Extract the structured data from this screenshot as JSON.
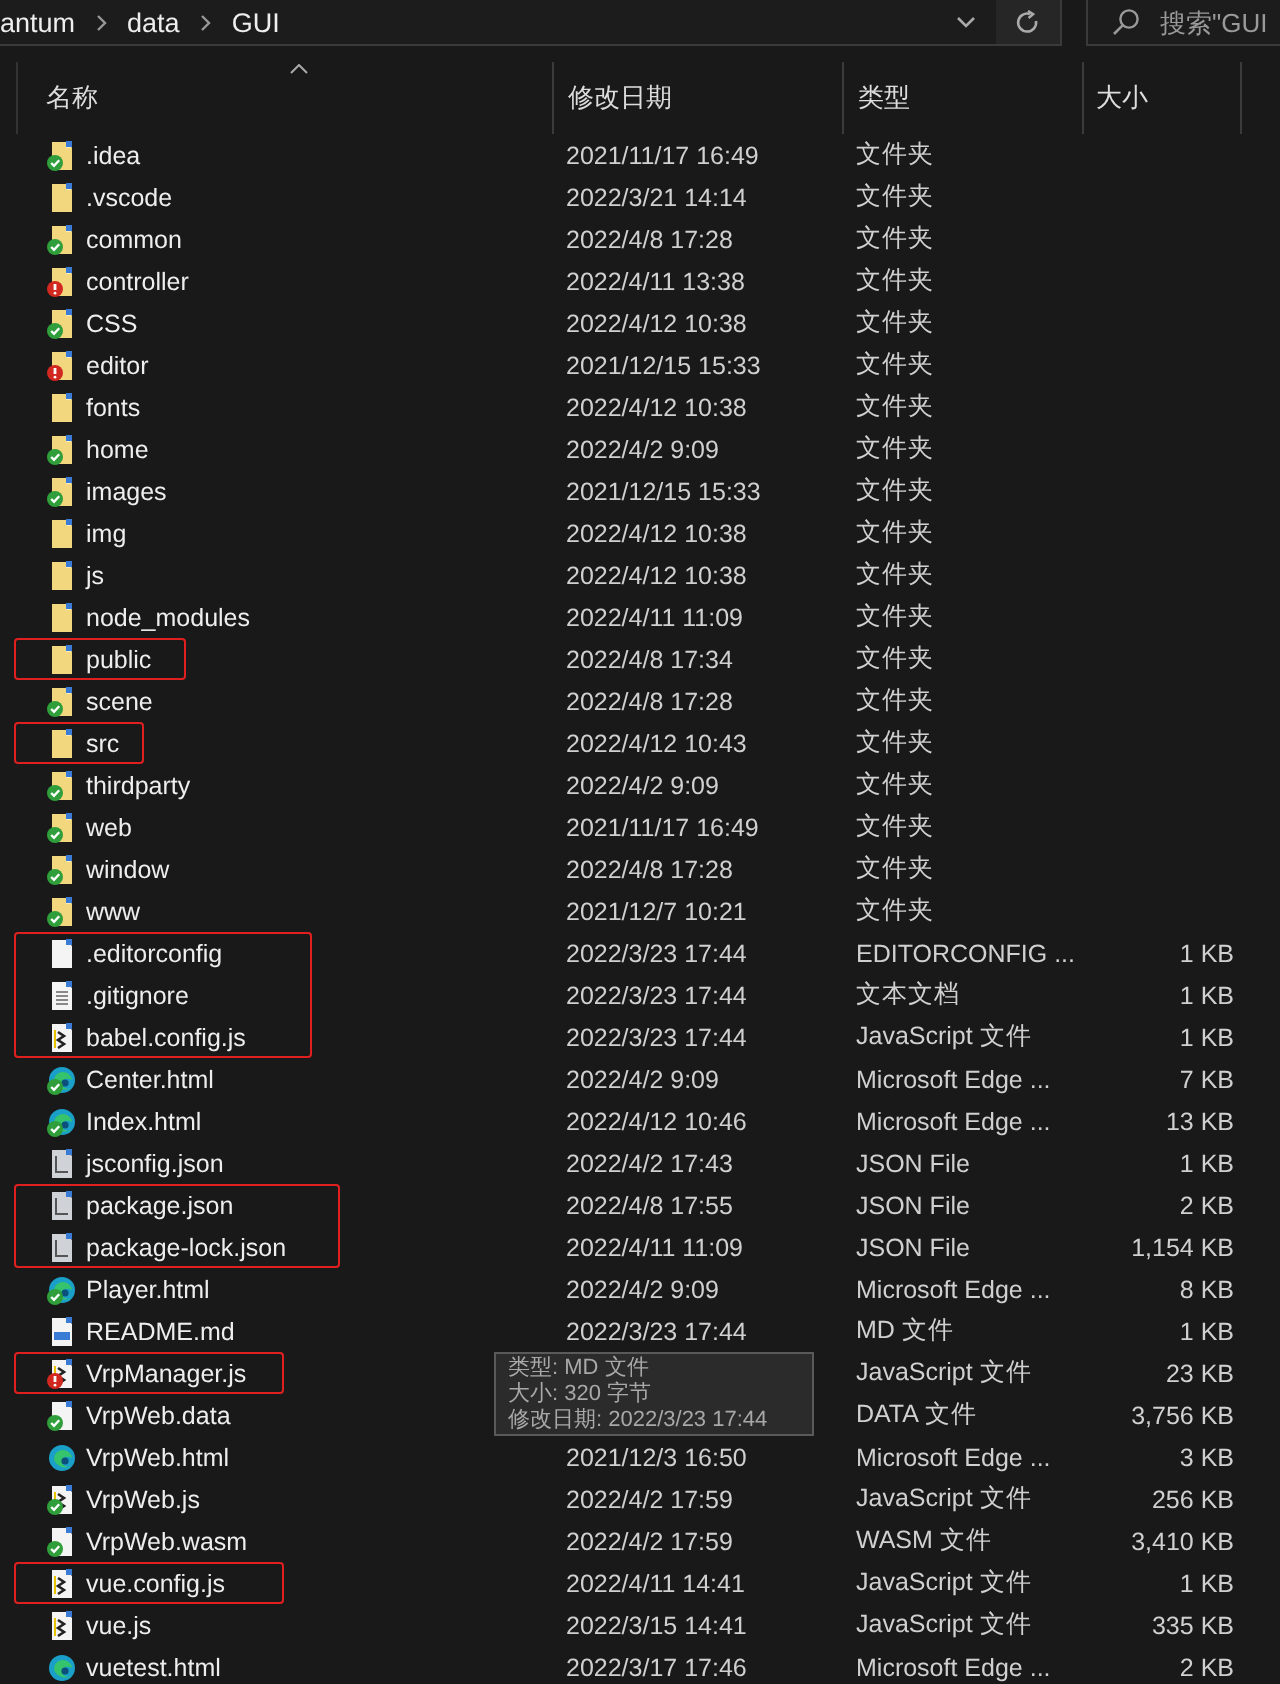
{
  "breadcrumb": [
    "antum",
    "data",
    "GUI"
  ],
  "search": {
    "placeholder": "搜索\"GUI"
  },
  "columns": [
    "名称",
    "修改日期",
    "类型",
    "大小"
  ],
  "files": [
    {
      "name": ".idea",
      "date": "2021/11/17 16:49",
      "type": "文件夹",
      "kind": "folder",
      "synced": true,
      "error": false,
      "marked": false
    },
    {
      "name": ".vscode",
      "date": "2022/3/21 14:14",
      "type": "文件夹",
      "kind": "folder",
      "synced": false,
      "error": false,
      "marked": false
    },
    {
      "name": "common",
      "date": "2022/4/8 17:28",
      "type": "文件夹",
      "kind": "folder",
      "synced": true,
      "error": false,
      "marked": false
    },
    {
      "name": "controller",
      "date": "2022/4/11 13:38",
      "type": "文件夹",
      "kind": "folder",
      "synced": false,
      "error": true,
      "marked": false
    },
    {
      "name": "CSS",
      "date": "2022/4/12 10:38",
      "type": "文件夹",
      "kind": "folder",
      "synced": true,
      "error": false,
      "marked": false
    },
    {
      "name": "editor",
      "date": "2021/12/15 15:33",
      "type": "文件夹",
      "kind": "folder",
      "synced": false,
      "error": true,
      "marked": false
    },
    {
      "name": "fonts",
      "date": "2022/4/12 10:38",
      "type": "文件夹",
      "kind": "folder",
      "synced": false,
      "error": false,
      "marked": false
    },
    {
      "name": "home",
      "date": "2022/4/2 9:09",
      "type": "文件夹",
      "kind": "folder",
      "synced": true,
      "error": false,
      "marked": false
    },
    {
      "name": "images",
      "date": "2021/12/15 15:33",
      "type": "文件夹",
      "kind": "folder",
      "synced": true,
      "error": false,
      "marked": false
    },
    {
      "name": "img",
      "date": "2022/4/12 10:38",
      "type": "文件夹",
      "kind": "folder",
      "synced": false,
      "error": false,
      "marked": false
    },
    {
      "name": "js",
      "date": "2022/4/12 10:38",
      "type": "文件夹",
      "kind": "folder",
      "synced": false,
      "error": false,
      "marked": false
    },
    {
      "name": "node_modules",
      "date": "2022/4/11 11:09",
      "type": "文件夹",
      "kind": "folder",
      "synced": false,
      "error": false,
      "marked": false
    },
    {
      "name": "public",
      "date": "2022/4/8 17:34",
      "type": "文件夹",
      "kind": "folder",
      "synced": false,
      "error": false,
      "marked": true
    },
    {
      "name": "scene",
      "date": "2022/4/8 17:28",
      "type": "文件夹",
      "kind": "folder",
      "synced": true,
      "error": false,
      "marked": false
    },
    {
      "name": "src",
      "date": "2022/4/12 10:43",
      "type": "文件夹",
      "kind": "folder",
      "synced": false,
      "error": false,
      "marked": true
    },
    {
      "name": "thirdparty",
      "date": "2022/4/2 9:09",
      "type": "文件夹",
      "kind": "folder",
      "synced": true,
      "error": false,
      "marked": false
    },
    {
      "name": "web",
      "date": "2021/11/17 16:49",
      "type": "文件夹",
      "kind": "folder",
      "synced": true,
      "error": false,
      "marked": false
    },
    {
      "name": "window",
      "date": "2022/4/8 17:28",
      "type": "文件夹",
      "kind": "folder",
      "synced": true,
      "error": false,
      "marked": false
    },
    {
      "name": "www",
      "date": "2021/12/7 10:21",
      "type": "文件夹",
      "kind": "folder",
      "synced": true,
      "error": false,
      "marked": false
    },
    {
      "name": ".editorconfig",
      "date": "2022/3/23 17:44",
      "type": "EDITORCONFIG ...",
      "size": "1 KB",
      "kind": "file",
      "synced": false,
      "error": false,
      "marked": true
    },
    {
      "name": ".gitignore",
      "date": "2022/3/23 17:44",
      "type": "文本文档",
      "size": "1 KB",
      "kind": "text",
      "synced": false,
      "error": false,
      "marked": true
    },
    {
      "name": "babel.config.js",
      "date": "2022/3/23 17:44",
      "type": "JavaScript 文件",
      "size": "1 KB",
      "kind": "script",
      "synced": false,
      "error": false,
      "marked": true
    },
    {
      "name": "Center.html",
      "date": "2022/4/2 9:09",
      "type": "Microsoft Edge ...",
      "size": "7 KB",
      "kind": "web",
      "synced": true,
      "error": false,
      "marked": false
    },
    {
      "name": "Index.html",
      "date": "2022/4/12 10:46",
      "type": "Microsoft Edge ...",
      "size": "13 KB",
      "kind": "web",
      "synced": true,
      "error": false,
      "marked": false
    },
    {
      "name": "jsconfig.json",
      "date": "2022/4/2 17:43",
      "type": "JSON File",
      "size": "1 KB",
      "kind": "json",
      "synced": false,
      "error": false,
      "marked": false
    },
    {
      "name": "package.json",
      "date": "2022/4/8 17:55",
      "type": "JSON File",
      "size": "2 KB",
      "kind": "json",
      "synced": false,
      "error": false,
      "marked": true
    },
    {
      "name": "package-lock.json",
      "date": "2022/4/11 11:09",
      "type": "JSON File",
      "size": "1,154 KB",
      "kind": "json",
      "synced": false,
      "error": false,
      "marked": true
    },
    {
      "name": "Player.html",
      "date": "2022/4/2 9:09",
      "type": "Microsoft Edge ...",
      "size": "8 KB",
      "kind": "web",
      "synced": true,
      "error": false,
      "marked": false
    },
    {
      "name": "README.md",
      "date": "2022/3/23 17:44",
      "type": "MD 文件",
      "size": "1 KB",
      "kind": "markdown",
      "synced": false,
      "error": false,
      "marked": false
    },
    {
      "name": "VrpManager.js",
      "type": "JavaScript 文件",
      "size": "23 KB",
      "kind": "script",
      "synced": false,
      "error": true,
      "marked": true
    },
    {
      "name": "VrpWeb.data",
      "type": "DATA 文件",
      "size": "3,756 KB",
      "kind": "file",
      "synced": true,
      "error": false,
      "marked": false
    },
    {
      "name": "VrpWeb.html",
      "date": "2021/12/3 16:50",
      "type": "Microsoft Edge ...",
      "size": "3 KB",
      "kind": "web",
      "synced": false,
      "error": false,
      "marked": false
    },
    {
      "name": "VrpWeb.js",
      "date": "2022/4/2 17:59",
      "type": "JavaScript 文件",
      "size": "256 KB",
      "kind": "script",
      "synced": true,
      "error": false,
      "marked": false
    },
    {
      "name": "VrpWeb.wasm",
      "date": "2022/4/2 17:59",
      "type": "WASM 文件",
      "size": "3,410 KB",
      "kind": "file",
      "synced": true,
      "error": false,
      "marked": false
    },
    {
      "name": "vue.config.js",
      "date": "2022/4/11 14:41",
      "type": "JavaScript 文件",
      "size": "1 KB",
      "kind": "script",
      "synced": false,
      "error": false,
      "marked": true
    },
    {
      "name": "vue.js",
      "date": "2022/3/15 14:41",
      "type": "JavaScript 文件",
      "size": "335 KB",
      "kind": "script",
      "synced": false,
      "error": false,
      "marked": false
    },
    {
      "name": "vuetest.html",
      "date": "2022/3/17 17:46",
      "type": "Microsoft Edge ...",
      "size": "2 KB",
      "kind": "web",
      "synced": false,
      "error": false,
      "marked": false
    }
  ],
  "tooltip": [
    "类型: MD 文件",
    "大小: 320 字节",
    "修改日期: 2022/3/23 17:44"
  ]
}
